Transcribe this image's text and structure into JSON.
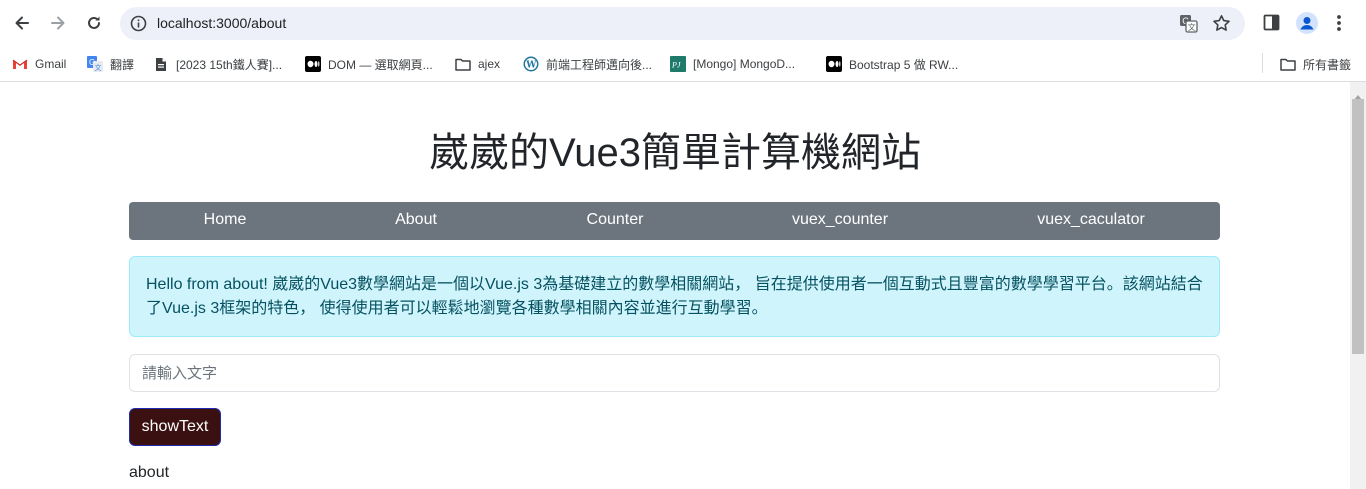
{
  "browser": {
    "url": "localhost:3000/about",
    "bookmarks": [
      {
        "label": "Gmail",
        "icon": "gmail-icon"
      },
      {
        "label": "翻譯",
        "icon": "google-translate-icon"
      },
      {
        "label": "[2023 15th鐵人賽]...",
        "icon": "document-icon"
      },
      {
        "label": "DOM — 選取網頁...",
        "icon": "medium-icon"
      },
      {
        "label": "ajex",
        "icon": "folder-icon"
      },
      {
        "label": "前端工程師邁向後...",
        "icon": "wordpress-icon"
      },
      {
        "label": "[Mongo] MongoD...",
        "icon": "pjchen-icon"
      },
      {
        "label": "Bootstrap 5 做 RW...",
        "icon": "medium-icon"
      }
    ],
    "all_bookmarks_label": "所有書籤"
  },
  "page": {
    "title": "崴崴的Vue3簡單計算機網站",
    "nav": [
      "Home",
      "About",
      "Counter",
      "vuex_counter",
      "vuex_caculator"
    ],
    "alert_text": "Hello from about! 崴崴的Vue3數學網站是一個以Vue.js 3為基礎建立的數學相關網站， 旨在提供使用者一個互動式且豐富的數學學習平台。該網站結合了Vue.js 3框架的特色， 使得使用者可以輕鬆地瀏覽各種數學相關內容並進行互動學習。",
    "input_placeholder": "請輸入文字",
    "input_value": "",
    "button_label": "showText",
    "output_text": "about"
  },
  "colors": {
    "nav_bg": "#6c757d",
    "alert_bg": "#cff4fc",
    "alert_text": "#055160",
    "button_bg": "#3b1010"
  }
}
